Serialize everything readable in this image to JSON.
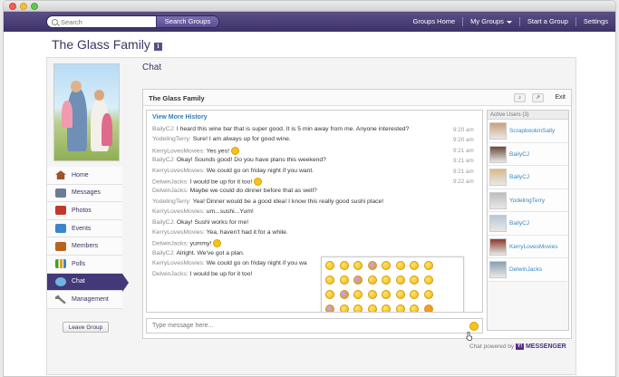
{
  "search": {
    "placeholder": "Search",
    "button": "Search Groups"
  },
  "nav": {
    "home": "Groups Home",
    "my_groups": "My Groups",
    "start": "Start a Group",
    "settings": "Settings"
  },
  "page": {
    "title": "The Glass Family"
  },
  "sidebar": {
    "items": [
      {
        "label": "Home",
        "icon": "home-icon",
        "color": "#a0522d"
      },
      {
        "label": "Messages",
        "icon": "messages-icon",
        "color": "#6b7a99"
      },
      {
        "label": "Photos",
        "icon": "photos-icon",
        "color": "#c0392b"
      },
      {
        "label": "Events",
        "icon": "calendar-icon",
        "color": "#3a86c8"
      },
      {
        "label": "Members",
        "icon": "members-icon",
        "color": "#b5651d"
      },
      {
        "label": "Polls",
        "icon": "polls-icon",
        "color": "#4c9a2a"
      },
      {
        "label": "Chat",
        "icon": "chat-icon",
        "color": "#6fb3e0"
      },
      {
        "label": "Management",
        "icon": "wrench-icon",
        "color": "#777777"
      }
    ],
    "leave_button": "Leave Group"
  },
  "chat": {
    "section_title": "Chat",
    "room_title": "The Glass Family",
    "exit_label": "Exit",
    "view_more": "View More History",
    "input_placeholder": "Type message here...",
    "messages": [
      {
        "user": "BailyCJ:",
        "text": "I heard this wine bar that is super good. It is 5 min away from me. Anyone interested?",
        "time": "9:20 am"
      },
      {
        "user": "YodelingTerry:",
        "text": "Sure! I am always up for good wine.",
        "time": "9:20 am"
      },
      {
        "user": "KerryLovesMovies:",
        "text": "Yes yes!",
        "time": "9:21 am",
        "emoticon": true
      },
      {
        "user": "BailyCJ:",
        "text": "Okay! Sounds good! Do you have plans this weekend?",
        "time": "9:21 am"
      },
      {
        "user": "KerryLovesMovies:",
        "text": "We could go on friday night if you want.",
        "time": "9:21 am"
      },
      {
        "user": "DelwinJacks:",
        "text": "I would be up for it too!",
        "time": "9:22 am",
        "emoticon": true
      },
      {
        "user": "DelwinJacks:",
        "text": "Maybe we could do dinner before that as well?",
        "time": ""
      },
      {
        "user": "YodelingTerry:",
        "text": "Yea! Dinner would be a good idea! I know this really good sushi place!",
        "time": ""
      },
      {
        "user": "KerryLovesMovies:",
        "text": "um...sushi...Yum!",
        "time": ""
      },
      {
        "user": "BailyCJ:",
        "text": "Okay! Sushi works for me!",
        "time": ""
      },
      {
        "user": "KerryLovesMovies:",
        "text": "Yea, haven't had it for a while.",
        "time": ""
      },
      {
        "user": "DelwinJacks:",
        "text": "yummy!",
        "time": "",
        "emoticon": true
      },
      {
        "user": "BailyCJ:",
        "text": "Alright. We've got a plan.",
        "time": ""
      },
      {
        "user": "KerryLovesMovies:",
        "text": "We could go on friday night if you wa",
        "time": ""
      },
      {
        "user": "DelwinJacks:",
        "text": "I would be up for it too!",
        "time": ""
      }
    ],
    "active_users_label": "Active Users (3)",
    "users": [
      {
        "name": "ScrapbookinSally",
        "color": "#c9a27a"
      },
      {
        "name": "BailyCJ",
        "color": "#6b4a3a"
      },
      {
        "name": "BailyCJ",
        "color": "#d9b98c"
      },
      {
        "name": "YodelingTerry",
        "color": "#bdbdbd"
      },
      {
        "name": "BailyCJ",
        "color": "#b8c7d6"
      },
      {
        "name": "KerryLovesMovies",
        "color": "#8a3a2a"
      },
      {
        "name": "DelwinJacks",
        "color": "#8aa0b0"
      }
    ],
    "powered_by": "Chat powered by",
    "brand": "MESSENGER"
  }
}
